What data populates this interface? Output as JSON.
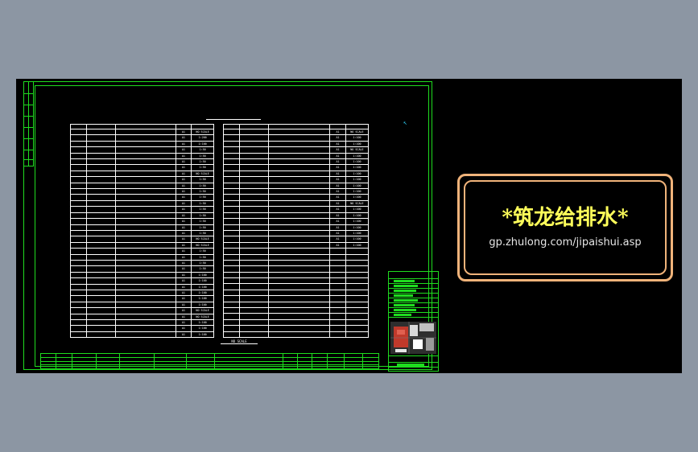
{
  "colors": {
    "background": "#8c96a3",
    "canvas": "#000000",
    "frame": "#1fdc1f",
    "lines": "#ffffff",
    "watermark_border": "#f0b37a",
    "watermark_text": "#ffff5a"
  },
  "watermark": {
    "title": "*筑龙给排水*",
    "url": "gp.zhulong.com/jipaishui.asp"
  },
  "schedule_left": {
    "rows": [
      {
        "size": "A1",
        "scale": "NO SCALE"
      },
      {
        "size": "A1",
        "scale": "1:200"
      },
      {
        "size": "A1",
        "scale": "1:100"
      },
      {
        "size": "A1",
        "scale": "1:50"
      },
      {
        "size": "A1",
        "scale": "1:50"
      },
      {
        "size": "A1",
        "scale": "1:50"
      },
      {
        "size": "A1",
        "scale": "1:50"
      },
      {
        "size": "A1",
        "scale": "NO SCALE"
      },
      {
        "size": "A1",
        "scale": "1:50"
      },
      {
        "size": "A1",
        "scale": "1:50"
      },
      {
        "size": "A1",
        "scale": "1:50"
      },
      {
        "size": "A1",
        "scale": "1:50"
      },
      {
        "size": "A1",
        "scale": "1:50"
      },
      {
        "size": "A1",
        "scale": "1:50"
      },
      {
        "size": "A1",
        "scale": "1:50"
      },
      {
        "size": "A1",
        "scale": "1:50"
      },
      {
        "size": "A1",
        "scale": "1:50"
      },
      {
        "size": "A1",
        "scale": "1:50"
      },
      {
        "size": "A1",
        "scale": "NO SCALE"
      },
      {
        "size": "A1",
        "scale": "NO SCALE"
      },
      {
        "size": "A1",
        "scale": "1:50"
      },
      {
        "size": "A1",
        "scale": "1:50"
      },
      {
        "size": "A1",
        "scale": "1:50"
      },
      {
        "size": "A1",
        "scale": "1:50"
      },
      {
        "size": "A1",
        "scale": "1:100"
      },
      {
        "size": "A1",
        "scale": "1:100"
      },
      {
        "size": "A1",
        "scale": "1:100"
      },
      {
        "size": "A1",
        "scale": "1:100"
      },
      {
        "size": "A1",
        "scale": "1:100"
      },
      {
        "size": "A1",
        "scale": "1:100"
      },
      {
        "size": "A1",
        "scale": "NO SCALE"
      },
      {
        "size": "A1",
        "scale": "NO SCALE"
      },
      {
        "size": "A1",
        "scale": "1:100"
      },
      {
        "size": "A1",
        "scale": "1:100"
      },
      {
        "size": "A1",
        "scale": "1:100"
      }
    ]
  },
  "schedule_right": {
    "rows": [
      {
        "size": "A1",
        "scale": "NO SCALE"
      },
      {
        "size": "A1",
        "scale": "1:100"
      },
      {
        "size": "A1",
        "scale": "1:100"
      },
      {
        "size": "A1",
        "scale": "NO SCALE"
      },
      {
        "size": "A1",
        "scale": "1:100"
      },
      {
        "size": "A1",
        "scale": "1:100"
      },
      {
        "size": "A1",
        "scale": "1:100"
      },
      {
        "size": "A1",
        "scale": "1:100"
      },
      {
        "size": "A1",
        "scale": "1:100"
      },
      {
        "size": "A1",
        "scale": "1:100"
      },
      {
        "size": "A1",
        "scale": "1:100"
      },
      {
        "size": "A1",
        "scale": "1:100"
      },
      {
        "size": "A1",
        "scale": "NO SCALE"
      },
      {
        "size": "A1",
        "scale": "1:100"
      },
      {
        "size": "A1",
        "scale": "1:100"
      },
      {
        "size": "A1",
        "scale": "1:100"
      },
      {
        "size": "A1",
        "scale": "1:100"
      },
      {
        "size": "A1",
        "scale": "1:100"
      },
      {
        "size": "A1",
        "scale": "1:100"
      },
      {
        "size": "A1",
        "scale": "1:100"
      }
    ],
    "blank_rows": 15
  },
  "scale_note": "NO SCALE"
}
